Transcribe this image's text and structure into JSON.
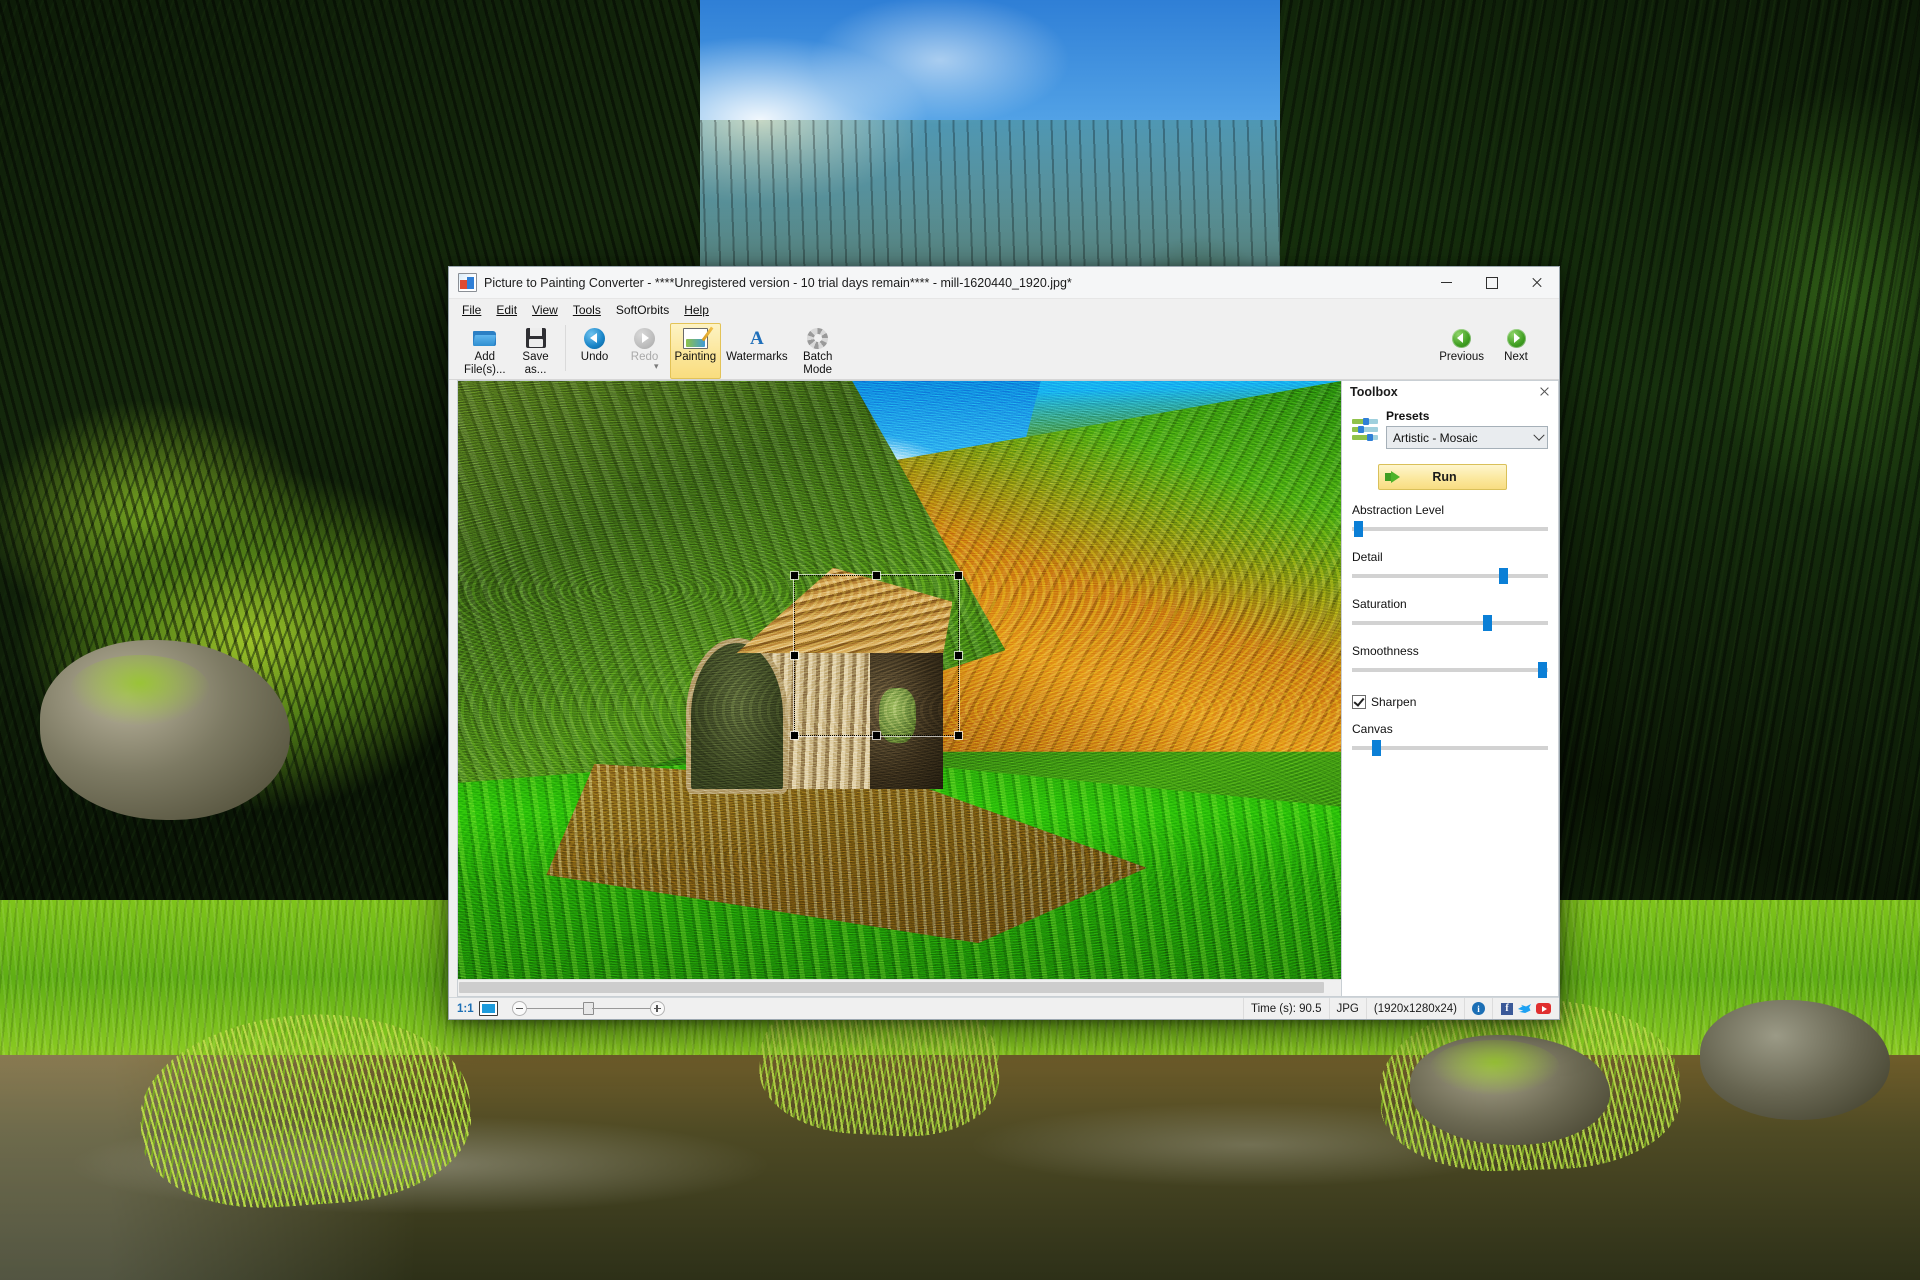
{
  "window": {
    "title": "Picture to Painting Converter - ****Unregistered version - 10 trial days remain**** - mill-1620440_1920.jpg*",
    "app_icon": "app-logo-icon",
    "controls": {
      "minimize": "minimize-icon",
      "maximize": "maximize-icon",
      "close": "close-icon"
    }
  },
  "menubar": {
    "items": [
      {
        "label": "File"
      },
      {
        "label": "Edit"
      },
      {
        "label": "View"
      },
      {
        "label": "Tools"
      },
      {
        "label": "SoftOrbits"
      },
      {
        "label": "Help"
      }
    ]
  },
  "toolbar": {
    "buttons": [
      {
        "label": "Add\nFile(s)...",
        "icon": "open-folder-icon",
        "state": "normal"
      },
      {
        "label": "Save\nas...",
        "icon": "floppy-disk-icon",
        "state": "normal"
      },
      {
        "label": "Undo",
        "icon": "undo-arrow-icon",
        "state": "normal"
      },
      {
        "label": "Redo",
        "icon": "redo-arrow-icon",
        "state": "disabled"
      },
      {
        "label": "Painting",
        "icon": "painting-icon",
        "state": "active"
      },
      {
        "label": "Watermarks",
        "icon": "letter-a-icon",
        "state": "normal"
      },
      {
        "label": "Batch\nMode",
        "icon": "gear-icon",
        "state": "normal"
      }
    ],
    "overflow_label": "▾",
    "nav": [
      {
        "label": "Previous",
        "icon": "arrow-left-circle-icon"
      },
      {
        "label": "Next",
        "icon": "arrow-right-circle-icon"
      }
    ]
  },
  "toolbox": {
    "title": "Toolbox",
    "close_icon": "close-icon",
    "presets_icon": "sliders-icon",
    "presets_label": "Presets",
    "preset_selected": "Artistic - Mosaic",
    "preset_options": [
      "Artistic - Mosaic"
    ],
    "run_label": "Run",
    "run_icon": "green-arrow-icon",
    "sliders": [
      {
        "label": "Abstraction Level",
        "percent": 1
      },
      {
        "label": "Detail",
        "percent": 77
      },
      {
        "label": "Saturation",
        "percent": 69
      },
      {
        "label": "Smoothness",
        "percent": 97
      },
      {
        "label": "Canvas",
        "percent": 12
      }
    ],
    "sharpen": {
      "label": "Sharpen",
      "checked": true
    }
  },
  "canvas": {
    "selection_visible": true
  },
  "statusbar": {
    "zoom_ratio": "1:1",
    "fit_icon": "fit-to-window-icon",
    "zoom_out_icon": "zoom-out-icon",
    "zoom_in_icon": "zoom-in-icon",
    "time": "Time (s): 90.5",
    "format": "JPG",
    "dimensions": "(1920x1280x24)",
    "info_icon": "info-icon",
    "social": [
      {
        "name": "facebook-icon",
        "glyph": "f"
      },
      {
        "name": "twitter-icon"
      },
      {
        "name": "youtube-icon"
      }
    ]
  },
  "colors": {
    "accent_blue": "#0b7fd6",
    "run_yellow": "#fbe89f",
    "active_tab": "#f9dd7f",
    "green_nav": "#3f9e21"
  }
}
